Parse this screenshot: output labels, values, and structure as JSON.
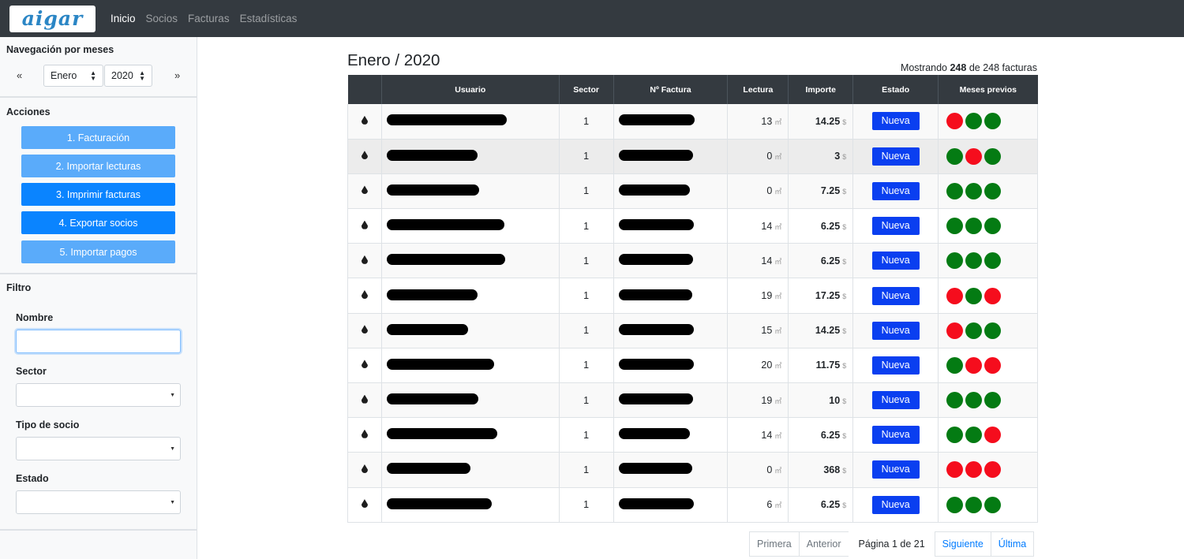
{
  "brand": {
    "logo_text": "aigar"
  },
  "nav": {
    "items": [
      "Inicio",
      "Socios",
      "Facturas",
      "Estadísticas"
    ]
  },
  "sidebar": {
    "month_nav_title": "Navegación por meses",
    "prev_arrow": "«",
    "next_arrow": "»",
    "month": "Enero",
    "year": "2020",
    "actions_title": "Acciones",
    "actions": [
      "1. Facturación",
      "2. Importar lecturas",
      "3. Imprimir facturas",
      "4. Exportar socios",
      "5. Importar pagos"
    ],
    "filter_title": "Filtro",
    "filter": {
      "name_label": "Nombre",
      "sector_label": "Sector",
      "member_type_label": "Tipo de socio",
      "status_label": "Estado"
    }
  },
  "main": {
    "title": "Enero / 2020",
    "showing": {
      "prefix": "Mostrando",
      "shown": "248",
      "middle": "de 248 facturas"
    },
    "columns": [
      "",
      "Usuario",
      "Sector",
      "Nº Factura",
      "Lectura",
      "Importe",
      "Estado",
      "Meses previos"
    ],
    "unit_reading": "㎥",
    "unit_amount": "$",
    "rows": [
      {
        "sector": "1",
        "lectura": "13",
        "importe": "14.25",
        "estado": "Nueva",
        "previos": [
          "r",
          "g",
          "g"
        ]
      },
      {
        "sector": "1",
        "lectura": "0",
        "importe": "3",
        "estado": "Nueva",
        "previos": [
          "g",
          "r",
          "g"
        ]
      },
      {
        "sector": "1",
        "lectura": "0",
        "importe": "7.25",
        "estado": "Nueva",
        "previos": [
          "g",
          "g",
          "g"
        ]
      },
      {
        "sector": "1",
        "lectura": "14",
        "importe": "6.25",
        "estado": "Nueva",
        "previos": [
          "g",
          "g",
          "g"
        ]
      },
      {
        "sector": "1",
        "lectura": "14",
        "importe": "6.25",
        "estado": "Nueva",
        "previos": [
          "g",
          "g",
          "g"
        ]
      },
      {
        "sector": "1",
        "lectura": "19",
        "importe": "17.25",
        "estado": "Nueva",
        "previos": [
          "r",
          "g",
          "r"
        ]
      },
      {
        "sector": "1",
        "lectura": "15",
        "importe": "14.25",
        "estado": "Nueva",
        "previos": [
          "r",
          "g",
          "g"
        ]
      },
      {
        "sector": "1",
        "lectura": "20",
        "importe": "11.75",
        "estado": "Nueva",
        "previos": [
          "g",
          "r",
          "r"
        ]
      },
      {
        "sector": "1",
        "lectura": "19",
        "importe": "10",
        "estado": "Nueva",
        "previos": [
          "g",
          "g",
          "g"
        ]
      },
      {
        "sector": "1",
        "lectura": "14",
        "importe": "6.25",
        "estado": "Nueva",
        "previos": [
          "g",
          "g",
          "r"
        ]
      },
      {
        "sector": "1",
        "lectura": "0",
        "importe": "368",
        "estado": "Nueva",
        "previos": [
          "r",
          "r",
          "r"
        ]
      },
      {
        "sector": "1",
        "lectura": "6",
        "importe": "6.25",
        "estado": "Nueva",
        "previos": [
          "g",
          "g",
          "g"
        ]
      }
    ],
    "status_colors": {
      "g": "#047b13",
      "r": "#f50d1d"
    }
  },
  "pagination": {
    "first": "Primera",
    "prev": "Anterior",
    "info": "Página 1 de 21",
    "next": "Siguiente",
    "last": "Última"
  }
}
